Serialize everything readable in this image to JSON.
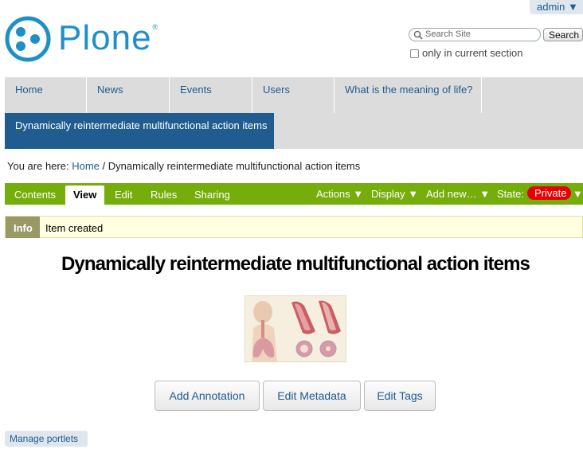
{
  "user_menu": {
    "label": "admin ▼"
  },
  "logo": {
    "text": "Plone",
    "reg": "®"
  },
  "search": {
    "placeholder": "Search Site",
    "button_label": "Search",
    "checkbox_label": "only in current section"
  },
  "global_nav": {
    "items": [
      {
        "label": "Home"
      },
      {
        "label": "News"
      },
      {
        "label": "Events"
      },
      {
        "label": "Users"
      },
      {
        "label": "What is the meaning of life?"
      }
    ],
    "active_label": "Dynamically reintermediate multifunctional action items"
  },
  "breadcrumb": {
    "prefix": "You are here:",
    "home": "Home",
    "separator": "/",
    "current": "Dynamically reintermediate multifunctional action items"
  },
  "edit_bar": {
    "tabs": {
      "contents": "Contents",
      "view": "View",
      "edit": "Edit",
      "rules": "Rules",
      "sharing": "Sharing"
    },
    "menus": {
      "actions": "Actions ▼",
      "display": "Display ▼",
      "add_new": "Add new… ▼",
      "state": "State:",
      "state_value": "Private",
      "state_arrow": "▼"
    },
    "colors": {
      "bar": "#75ad0a",
      "state": "#e60000"
    }
  },
  "message": {
    "label": "Info",
    "text": "Item created"
  },
  "page": {
    "title": "Dynamically reintermediate multifunctional action items",
    "image": "respiratory-system-illustration"
  },
  "buttons": {
    "add_annotation": "Add Annotation",
    "edit_metadata": "Edit Metadata",
    "edit_tags": "Edit Tags"
  },
  "manage_portlets": "Manage portlets",
  "colors": {
    "link": "#205c90",
    "logo": "#1f8fc9",
    "nav_active": "#205c90"
  }
}
